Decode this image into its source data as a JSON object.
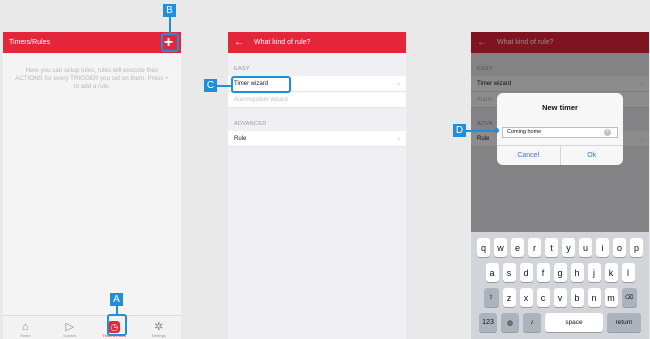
{
  "screen1": {
    "title": "Timers/Rules",
    "plus_icon": "plus-icon",
    "info": "Here you can setup rules, rules will execute their ACTIONS for every TRIGGER you set on them. Press + to add a rule.",
    "tabs": [
      {
        "label": "Home",
        "icon": "home-icon"
      },
      {
        "label": "Scenes",
        "icon": "play-circle-icon"
      },
      {
        "label": "Timers/Rules",
        "icon": "timer-icon"
      },
      {
        "label": "Settings",
        "icon": "gear-icon"
      }
    ]
  },
  "screen2": {
    "title": "What kind of rule?",
    "easy_header": "EASY",
    "timer_wizard": "Timer wizard",
    "alarm_wizard": "Alarmsystem wizard",
    "advanced_header": "ADVANCED",
    "rule": "Rule"
  },
  "screen3": {
    "title": "What kind of rule?",
    "easy_header": "EASY",
    "timer_wizard": "Timer wizard",
    "alarm_partial": "Alarm",
    "advanced_partial": "ADVA",
    "rule": "Rule",
    "dialog": {
      "title": "New timer",
      "input_value": "Coming home",
      "cancel": "Cancel",
      "ok": "Ok"
    },
    "keyboard": {
      "row1": [
        "q",
        "w",
        "e",
        "r",
        "t",
        "y",
        "u",
        "i",
        "o",
        "p"
      ],
      "row2": [
        "a",
        "s",
        "d",
        "f",
        "g",
        "h",
        "j",
        "k",
        "l"
      ],
      "row3": [
        "z",
        "x",
        "c",
        "v",
        "b",
        "n",
        "m"
      ],
      "shift_icon": "shift-icon",
      "backspace_icon": "backspace-icon",
      "num_key": "123",
      "globe_icon": "globe-icon",
      "mic_icon": "microphone-icon",
      "space": "space",
      "return": "return"
    }
  },
  "callouts": {
    "a": "A",
    "b": "B",
    "c": "C",
    "d": "D"
  },
  "colors": {
    "brand_red": "#e5253a",
    "callout_blue": "#1e8fd8",
    "link_blue": "#2b7dd9"
  }
}
